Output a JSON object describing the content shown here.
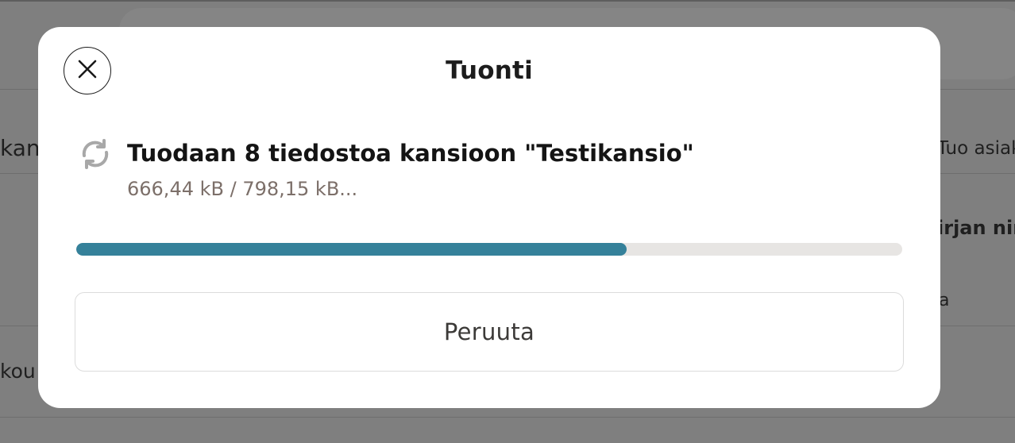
{
  "background": {
    "fragments": [
      "kan",
      "kou",
      "Tuo asiak",
      "irjan nim",
      "a"
    ]
  },
  "modal": {
    "title": "Tuonti",
    "close_icon": "close-icon",
    "status": {
      "icon": "sync-icon",
      "title": "Tuodaan 8 tiedostoa kansioon \"Testikansio\"",
      "progress_text": "666,44 kB / 798,15 kB..."
    },
    "progress": {
      "percent": 66.6,
      "fill_color": "#35819a",
      "track_color": "#e7e5e3"
    },
    "cancel_label": "Peruuta"
  }
}
